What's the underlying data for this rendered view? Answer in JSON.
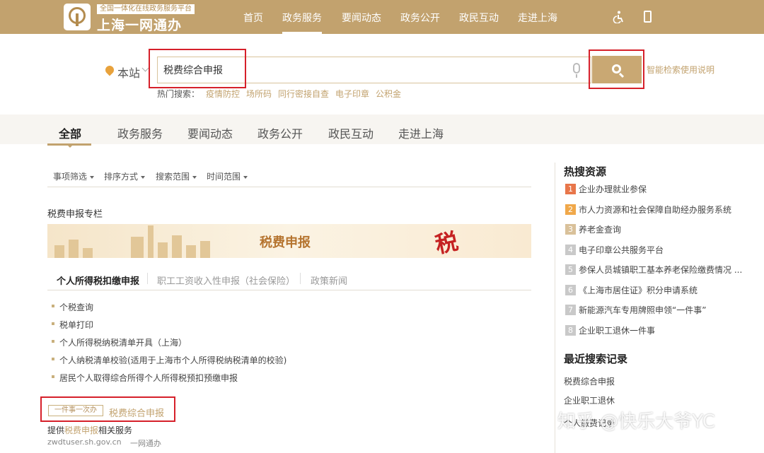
{
  "header": {
    "logo_tag": "全国一体化在线政务服务平台",
    "logo_name": "上海一网通办",
    "nav": [
      "首页",
      "政务服务",
      "要闻动态",
      "政务公开",
      "政民互动",
      "走进上海"
    ],
    "active_nav": "政务服务"
  },
  "search": {
    "location": "本站",
    "query": "税费综合申报",
    "help_link": "智能检索使用说明",
    "hot_label": "热门搜索：",
    "hot_keywords": [
      "疫情防控",
      "场所码",
      "同行密接自查",
      "电子印章",
      "公积金"
    ]
  },
  "tabs": [
    "全部",
    "政务服务",
    "要闻动态",
    "政务公开",
    "政民互动",
    "走进上海"
  ],
  "filters": [
    "事项筛选",
    "排序方式",
    "搜索范围",
    "时间范围"
  ],
  "section": {
    "title": "税费申报专栏",
    "banner_title": "税费申报",
    "banner_art": "税",
    "sub_tabs": [
      "个人所得税扣缴申报",
      "职工工资收入性申报（社会保险）",
      "政策新闻"
    ],
    "items": [
      "个税查询",
      "税单打印",
      "个人所得税纳税清单开具（上海）",
      "个人纳税清单校验(适用于上海市个人所得税纳税清单的校验)",
      "居民个人取得综合所得个人所得税预扣预缴申报"
    ]
  },
  "result": {
    "badge": "一件事一次办",
    "title": "税费综合申报",
    "desc_prefix": "提供",
    "desc_highlight": "税费申报",
    "desc_suffix": "相关服务",
    "url": "zwdtuser.sh.gov.cn",
    "source": "一网通办"
  },
  "hot_resources": {
    "title": "热搜资源",
    "items": [
      {
        "rank": "1",
        "label": "企业办理就业参保",
        "color": "#e8764a"
      },
      {
        "rank": "2",
        "label": "市人力资源和社会保障自助经办服务系统",
        "color": "#f0a84a"
      },
      {
        "rank": "3",
        "label": "养老金查询",
        "color": "#d9c19a"
      },
      {
        "rank": "4",
        "label": "电子印章公共服务平台",
        "color": "#c9c9c9"
      },
      {
        "rank": "5",
        "label": "参保人员城镇职工基本养老保险缴费情况 ...",
        "color": "#c9c9c9"
      },
      {
        "rank": "6",
        "label": "《上海市居住证》积分申请系统",
        "color": "#c9c9c9"
      },
      {
        "rank": "7",
        "label": "新能源汽车专用牌照申领“一件事”",
        "color": "#c9c9c9"
      },
      {
        "rank": "8",
        "label": "企业职工退休一件事",
        "color": "#c9c9c9"
      }
    ]
  },
  "recent_searches": {
    "title": "最近搜索记录",
    "items": [
      "税费综合申报",
      "企业职工退休",
      "个人缴费记录"
    ]
  },
  "watermark": "知乎 @快乐大爷YC",
  "colors": {
    "brand_gold": "#c2a26e",
    "highlight_red": "#d6202a"
  }
}
